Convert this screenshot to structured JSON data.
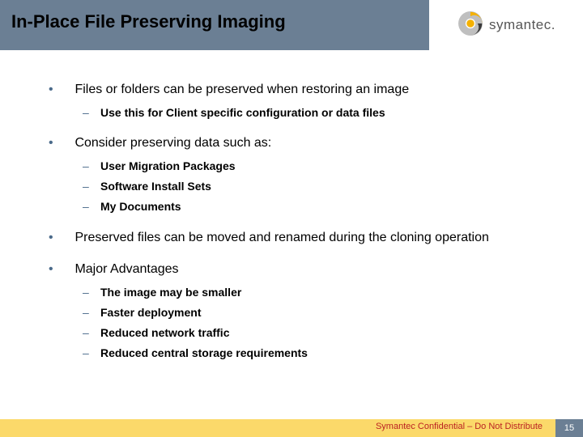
{
  "title": "In-Place File Preserving Imaging",
  "brand": "symantec.",
  "bullets": [
    {
      "text": "Files or folders can be preserved when restoring an image",
      "sub": [
        "Use this for Client specific configuration or data files"
      ]
    },
    {
      "text": "Consider preserving data such as:",
      "sub": [
        "User Migration Packages",
        "Software Install Sets",
        "My Documents"
      ]
    },
    {
      "text": "Preserved files can be moved and renamed during the cloning operation",
      "sub": []
    },
    {
      "text": "Major Advantages",
      "sub": [
        "The image may be smaller",
        "Faster deployment",
        "Reduced network traffic",
        "Reduced central storage requirements"
      ]
    }
  ],
  "footer": "Symantec Confidential – Do Not Distribute",
  "page": "15"
}
